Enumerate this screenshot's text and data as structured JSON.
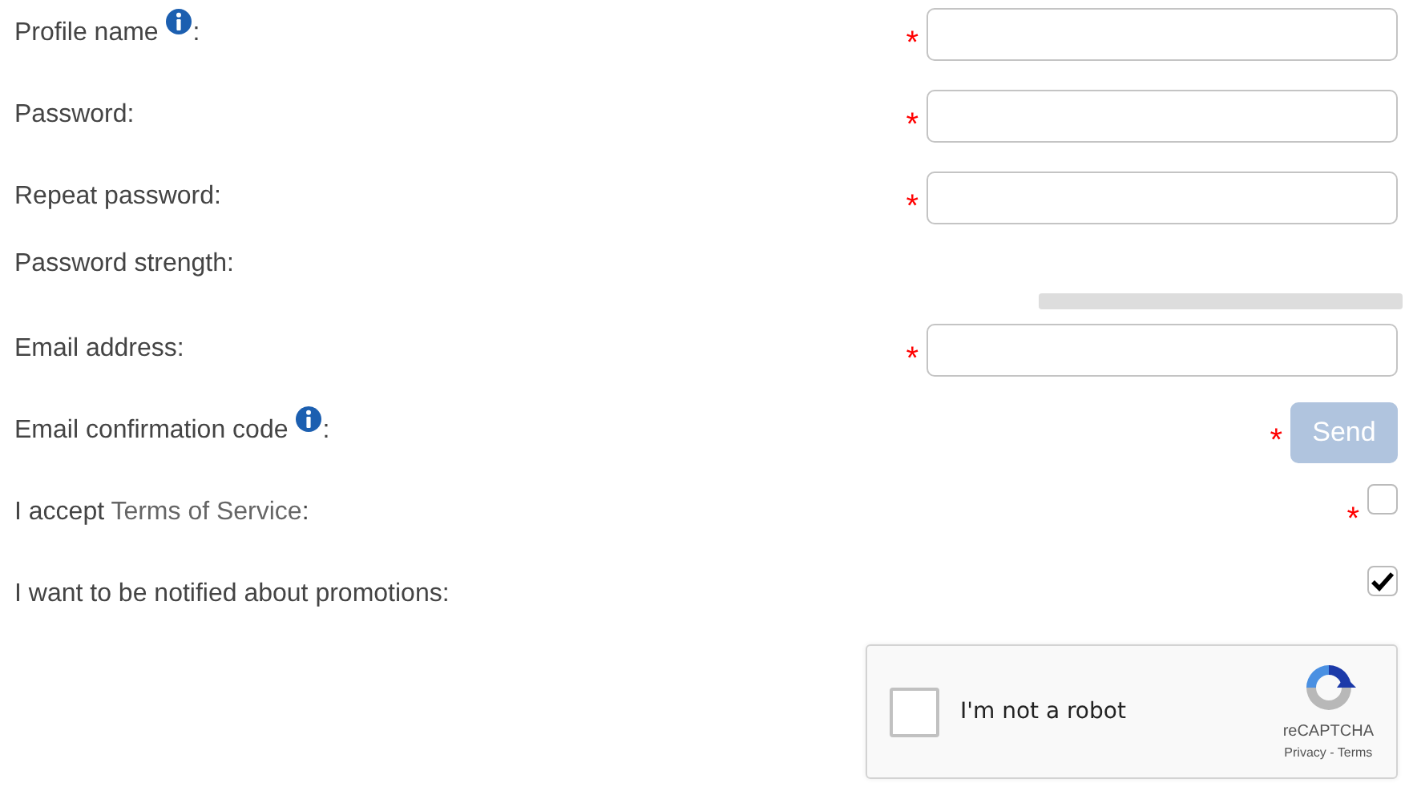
{
  "fields": [
    {
      "kind": "input",
      "label": [
        {
          "kind": "text",
          "text": "Profile name "
        },
        {
          "kind": "info"
        },
        {
          "kind": "text",
          "text": ":"
        }
      ],
      "required_mark": "*"
    },
    {
      "kind": "input",
      "label": [
        {
          "kind": "text",
          "text": "Password:"
        }
      ],
      "required_mark": "*"
    },
    {
      "kind": "input",
      "label": [
        {
          "kind": "text",
          "text": "Repeat password:"
        }
      ],
      "required_mark": "*"
    },
    {
      "kind": "meter",
      "label": [
        {
          "kind": "text",
          "text": "Password strength:"
        }
      ],
      "level": 0
    },
    {
      "kind": "input",
      "label": [
        {
          "kind": "text",
          "text": "Email address:"
        }
      ],
      "required_mark": "*"
    },
    {
      "kind": "button",
      "label": [
        {
          "kind": "text",
          "text": "Email confirmation code "
        },
        {
          "kind": "info"
        },
        {
          "kind": "text",
          "text": ":"
        }
      ],
      "required_mark": "*",
      "button": {
        "text": "Send",
        "disabled": true
      }
    },
    {
      "kind": "checkbox",
      "label": [
        {
          "kind": "text",
          "text": "I accept "
        },
        {
          "kind": "link",
          "text": "Terms of Service"
        },
        {
          "kind": "text",
          "text": ":"
        }
      ],
      "required_mark": "*",
      "checked": false
    },
    {
      "kind": "checkbox",
      "label": [
        {
          "kind": "text",
          "text": "I want to be notified about promotions:"
        }
      ],
      "checked": true
    }
  ],
  "captcha": {
    "text": "I'm not a robot",
    "checked": false,
    "brand": "reCAPTCHA",
    "links": "Privacy - Terms"
  }
}
